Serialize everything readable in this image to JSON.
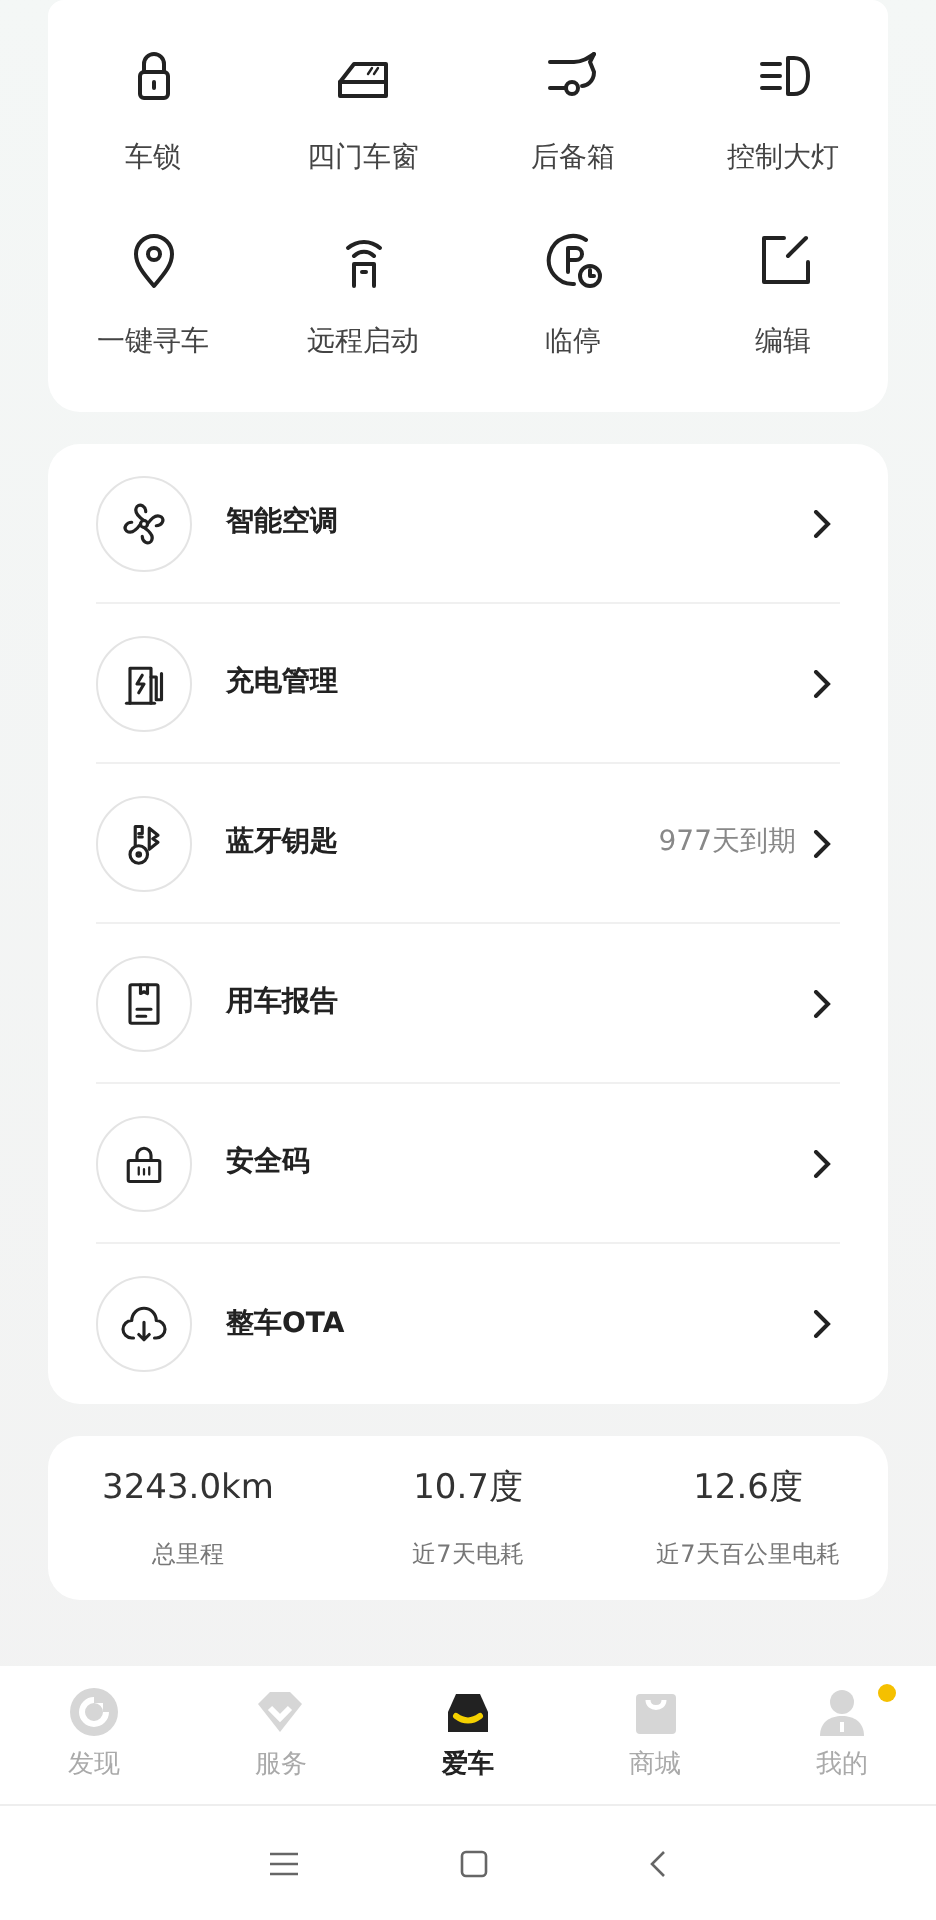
{
  "quick_actions": [
    {
      "label": "车锁"
    },
    {
      "label": "四门车窗"
    },
    {
      "label": "后备箱"
    },
    {
      "label": "控制大灯"
    },
    {
      "label": "一键寻车"
    },
    {
      "label": "远程启动"
    },
    {
      "label": "临停"
    },
    {
      "label": "编辑"
    }
  ],
  "menu": [
    {
      "label": "智能空调"
    },
    {
      "label": "充电管理"
    },
    {
      "label": "蓝牙钥匙",
      "detail": "977天到期"
    },
    {
      "label": "用车报告"
    },
    {
      "label": "安全码"
    },
    {
      "label": "整车OTA"
    }
  ],
  "stats": [
    {
      "value": "3243.0km",
      "label": "总里程"
    },
    {
      "value": "10.7度",
      "label": "近7天电耗"
    },
    {
      "value": "12.6度",
      "label": "近7天百公里电耗"
    }
  ],
  "tab_bar": [
    {
      "label": "发现",
      "selected": false,
      "badge": false
    },
    {
      "label": "服务",
      "selected": false,
      "badge": false
    },
    {
      "label": "爱车",
      "selected": true,
      "badge": false
    },
    {
      "label": "商城",
      "selected": false,
      "badge": false
    },
    {
      "label": "我的",
      "selected": false,
      "badge": true
    }
  ]
}
